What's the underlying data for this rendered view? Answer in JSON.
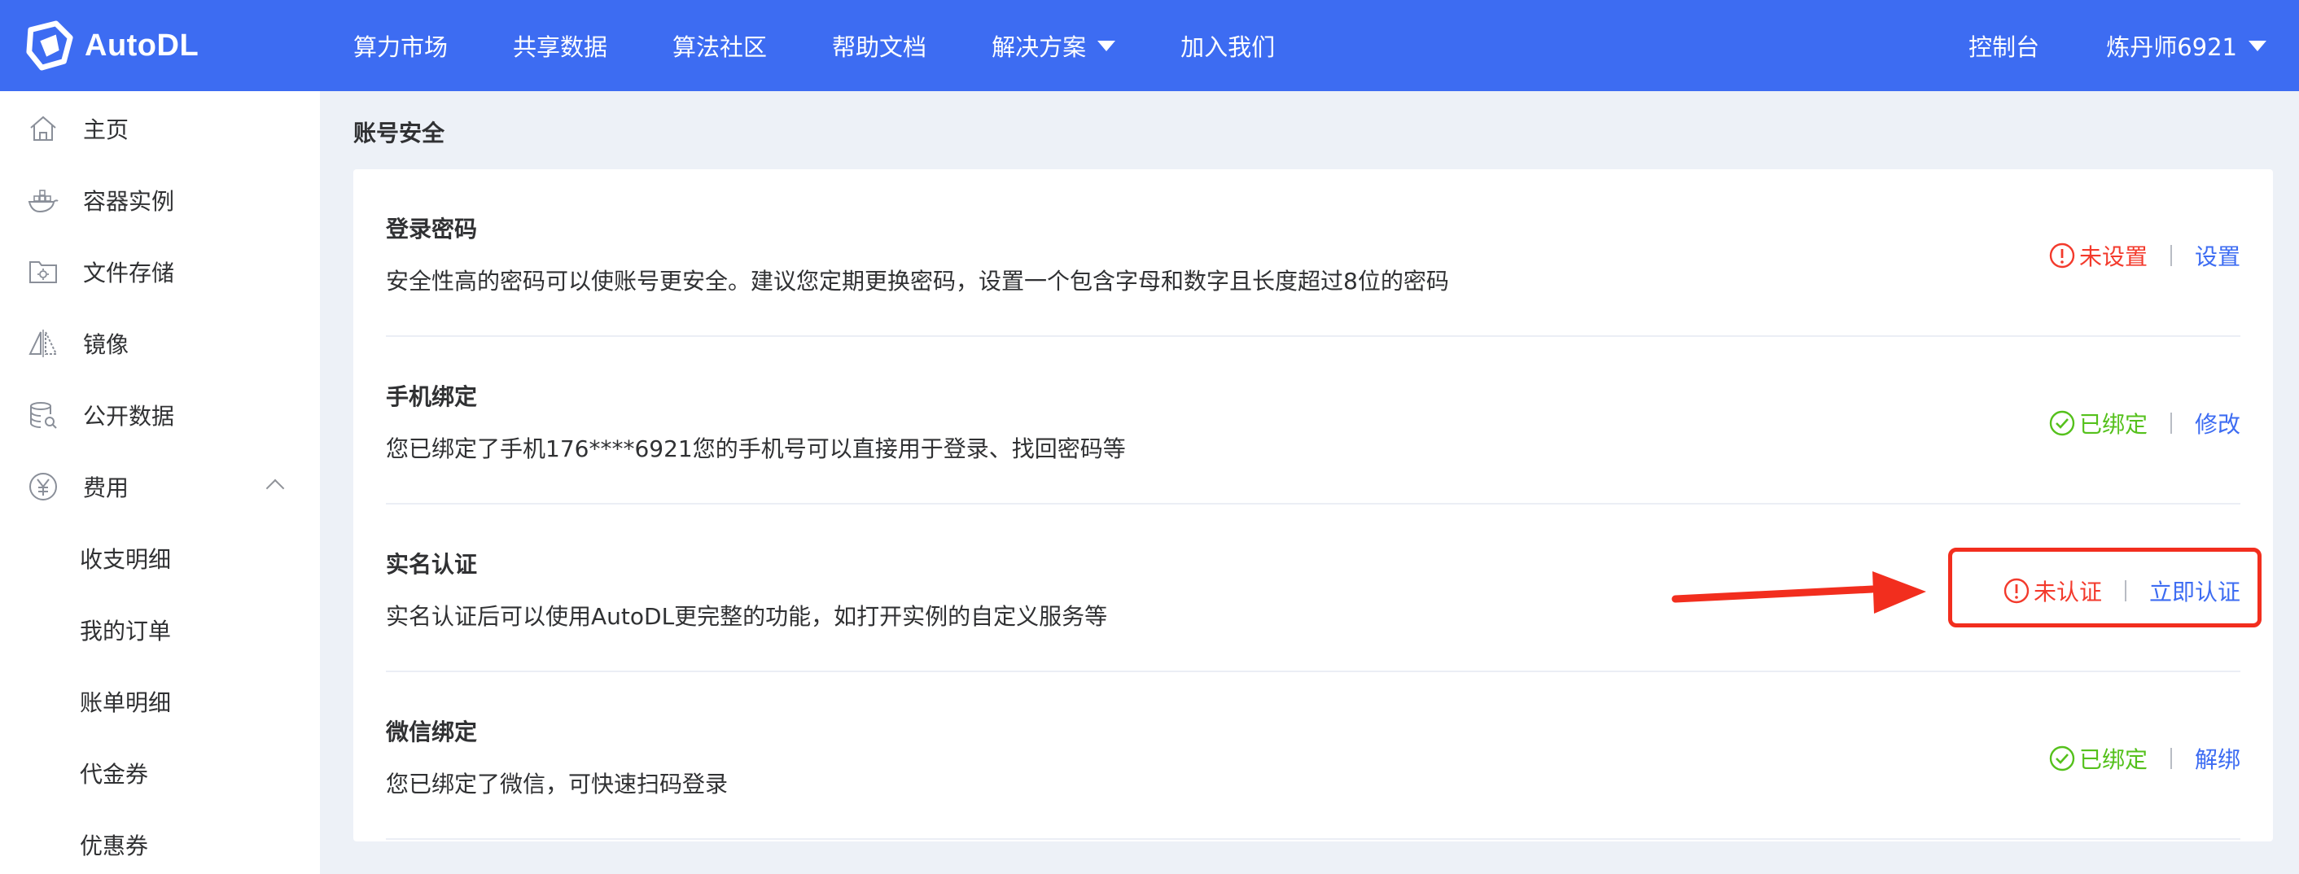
{
  "header": {
    "logo_text": "AutoDL",
    "nav": [
      "算力市场",
      "共享数据",
      "算法社区",
      "帮助文档",
      "解决方案",
      "加入我们"
    ],
    "console": "控制台",
    "user": "炼丹师6921"
  },
  "sidebar": {
    "items": [
      {
        "label": "主页",
        "icon": "home-icon"
      },
      {
        "label": "容器实例",
        "icon": "container-icon"
      },
      {
        "label": "文件存储",
        "icon": "folder-gear-icon"
      },
      {
        "label": "镜像",
        "icon": "mirror-icon"
      },
      {
        "label": "公开数据",
        "icon": "database-icon"
      },
      {
        "label": "费用",
        "icon": "yen-icon"
      }
    ],
    "sub_items": [
      "收支明细",
      "我的订单",
      "账单明细",
      "代金券",
      "优惠券"
    ]
  },
  "page": {
    "title": "账号安全"
  },
  "security": {
    "rows": [
      {
        "title": "登录密码",
        "desc": "安全性高的密码可以使账号更安全。建议您定期更换密码，设置一个包含字母和数字且长度超过8位的密码",
        "status": "未设置",
        "status_type": "warn",
        "action": "设置"
      },
      {
        "title": "手机绑定",
        "desc": "您已绑定了手机176****6921您的手机号可以直接用于登录、找回密码等",
        "status": "已绑定",
        "status_type": "ok",
        "action": "修改"
      },
      {
        "title": "实名认证",
        "desc": "实名认证后可以使用AutoDL更完整的功能，如打开实例的自定义服务等",
        "status": "未认证",
        "status_type": "warn",
        "action": "立即认证"
      },
      {
        "title": "微信绑定",
        "desc": "您已绑定了微信，可快速扫码登录",
        "status": "已绑定",
        "status_type": "ok",
        "action": "解绑"
      }
    ]
  },
  "colors": {
    "brand": "#3d6cf2",
    "warn": "#f33a2c",
    "ok": "#55c11c",
    "annotation": "#f22e1e"
  }
}
